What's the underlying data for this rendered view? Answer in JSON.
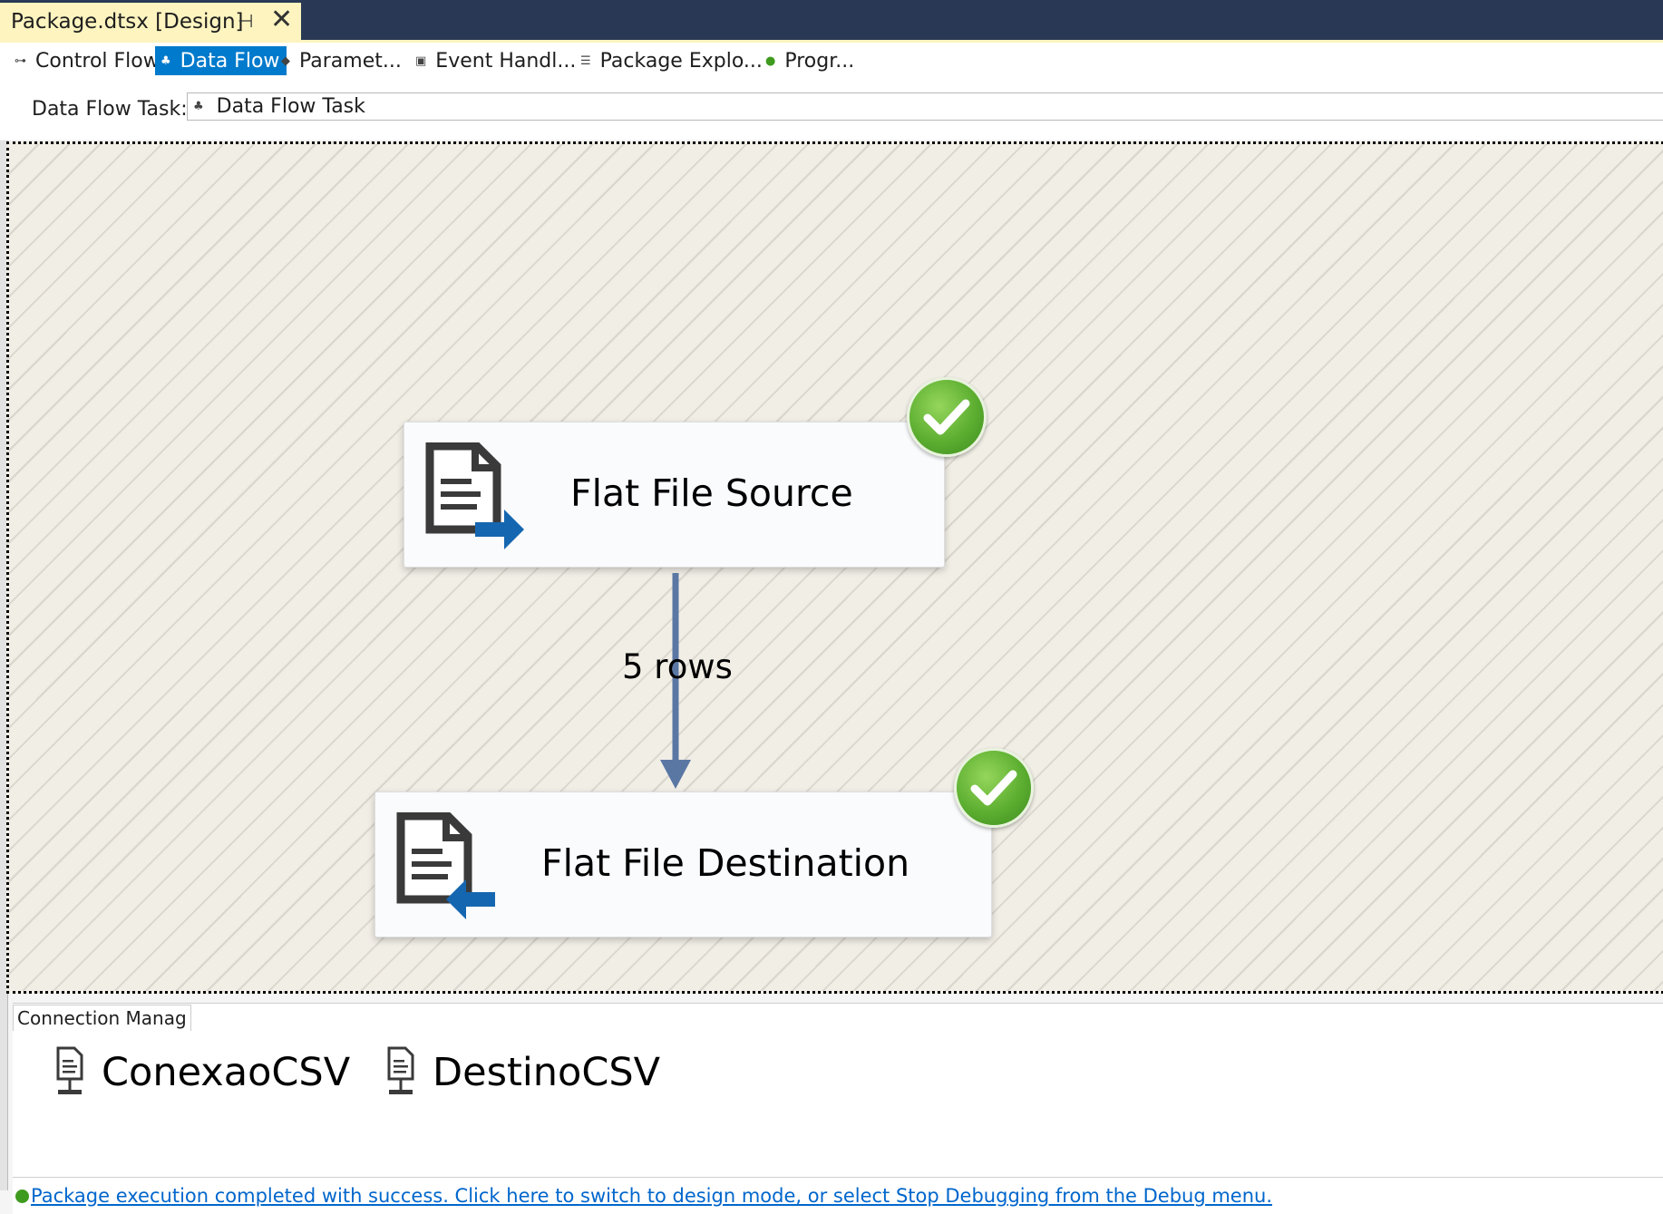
{
  "document_tab": {
    "title": "Package.dtsx [Design]",
    "pin_icon": "pin-icon",
    "close_icon": "close-icon"
  },
  "designer_tabs": [
    {
      "label": "Control Flow",
      "icon": "control-flow-icon",
      "active": false
    },
    {
      "label": "Data Flow",
      "icon": "data-flow-icon",
      "active": true
    },
    {
      "label": "Paramet...",
      "icon": "parameters-icon",
      "active": false
    },
    {
      "label": "Event Handl...",
      "icon": "event-handlers-icon",
      "active": false
    },
    {
      "label": "Package Explo...",
      "icon": "package-explorer-icon",
      "active": false
    },
    {
      "label": "Progr...",
      "icon": "progress-icon",
      "active": false
    }
  ],
  "task_selector": {
    "label": "Data Flow Task:",
    "value": "Data Flow Task",
    "icon": "data-flow-task-icon"
  },
  "canvas": {
    "source": {
      "label": "Flat File Source",
      "status": "success"
    },
    "destination": {
      "label": "Flat File Destination",
      "status": "success"
    },
    "path": {
      "label": "5 rows"
    }
  },
  "connection_managers": {
    "tab_label": "Connection Manag",
    "items": [
      {
        "label": "ConexaoCSV",
        "icon": "flat-file-connection-icon"
      },
      {
        "label": "DestinoCSV",
        "icon": "flat-file-connection-icon"
      }
    ]
  },
  "status_bar": {
    "message": "Package execution completed with success. Click here to switch to design mode, or select Stop Debugging from the Debug menu."
  },
  "colors": {
    "title_bar": "#293955",
    "active_tab": "#007acc",
    "doc_tab": "#fdf4bf",
    "canvas_background": "#f1eee6",
    "path_arrow": "#5a77a4",
    "success_green": "#5cae30",
    "link": "#0066cc"
  }
}
